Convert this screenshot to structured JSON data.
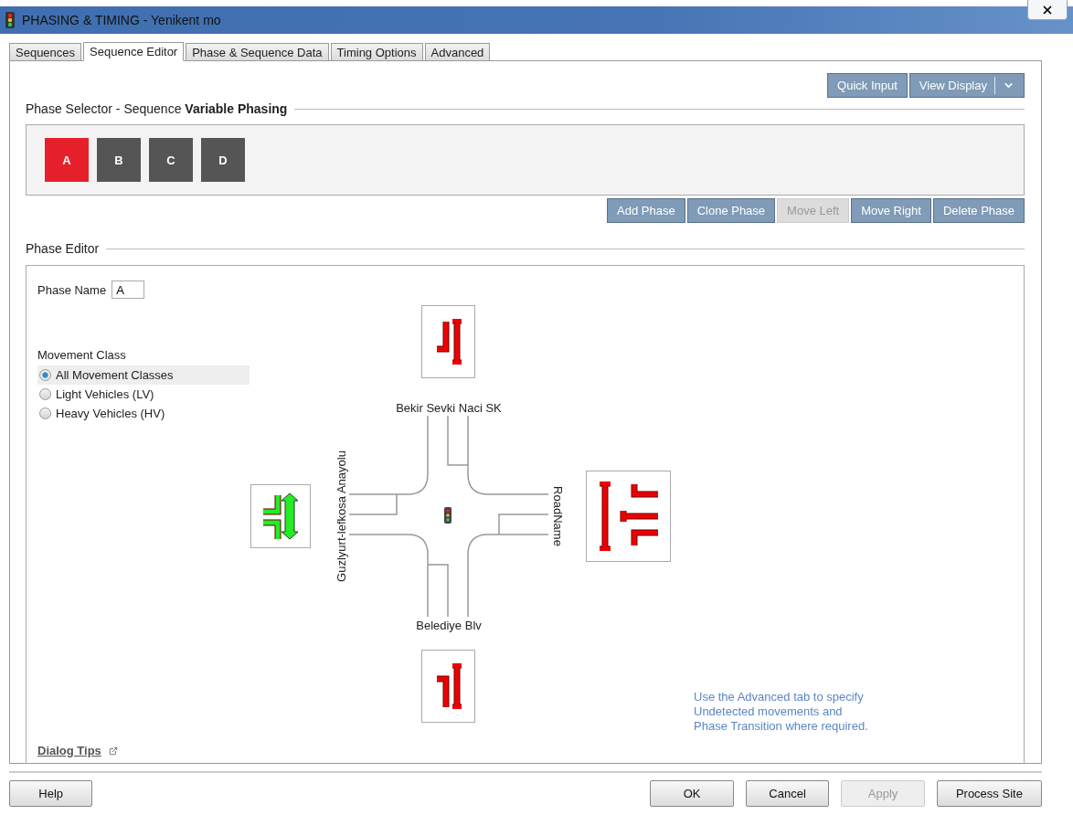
{
  "window": {
    "title": "PHASING & TIMING - Yenikent mo"
  },
  "tabs": [
    {
      "label": "Sequences",
      "selected": false
    },
    {
      "label": "Sequence Editor",
      "selected": true
    },
    {
      "label": "Phase & Sequence Data",
      "selected": false
    },
    {
      "label": "Timing Options",
      "selected": false
    },
    {
      "label": "Advanced",
      "selected": false
    }
  ],
  "toolbar": {
    "quick_input": "Quick Input",
    "view_display": "View Display"
  },
  "phase_selector": {
    "title": "Phase Selector - Sequence **Variable Phasing**",
    "phases": [
      {
        "label": "A",
        "selected": true
      },
      {
        "label": "B",
        "selected": false
      },
      {
        "label": "C",
        "selected": false
      },
      {
        "label": "D",
        "selected": false
      }
    ],
    "actions": [
      {
        "label": "Add Phase",
        "disabled": false
      },
      {
        "label": "Clone Phase",
        "disabled": false
      },
      {
        "label": "Move Left",
        "disabled": true
      },
      {
        "label": "Move Right",
        "disabled": false
      },
      {
        "label": "Delete Phase",
        "disabled": false
      }
    ]
  },
  "phase_editor": {
    "title": "Phase Editor",
    "phase_name_label": "Phase Name",
    "phase_name": "A",
    "movement_class_label": "Movement Class",
    "movement_classes": [
      {
        "label": "All Movement Classes",
        "selected": true
      },
      {
        "label": "Light Vehicles (LV)",
        "selected": false
      },
      {
        "label": "Heavy Vehicles (HV)",
        "selected": false
      }
    ],
    "approaches": [
      {
        "kind": "north",
        "road": "Bekir Sevki Naci SK",
        "running": false
      },
      {
        "kind": "west",
        "road": "Guzlyurt-lefkosa Anayolu",
        "running": true
      },
      {
        "kind": "east",
        "road": "RoadName",
        "running": false
      },
      {
        "kind": "south",
        "road": "Belediye Blv",
        "running": false
      }
    ],
    "note": "Use the Advanced tab to specify Undetected movements and Phase Transition where required.",
    "dialog_tips": "Dialog Tips"
  },
  "buttons": [
    {
      "label": "Help",
      "disabled": false
    },
    {
      "label": "OK",
      "disabled": false
    },
    {
      "label": "Cancel",
      "disabled": false
    },
    {
      "label": "Apply",
      "disabled": true
    },
    {
      "label": "Process Site",
      "disabled": false
    }
  ]
}
